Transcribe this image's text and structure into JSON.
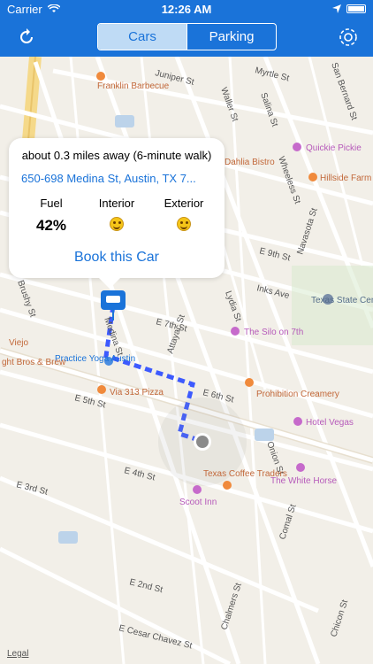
{
  "status": {
    "carrier": "Carrier",
    "time": "12:26 AM"
  },
  "nav": {
    "tabs": [
      {
        "label": "Cars",
        "active": true
      },
      {
        "label": "Parking",
        "active": false
      }
    ]
  },
  "popup": {
    "distance": "about 0.3 miles away (6-minute walk)",
    "address": "650-698 Medina St, Austin, TX 7...",
    "fuel_label": "Fuel",
    "fuel_value": "42%",
    "interior_label": "Interior",
    "exterior_label": "Exterior",
    "book_label": "Book this Car"
  },
  "map": {
    "streets": [
      "Juniper St",
      "Myrtle St",
      "Waller St",
      "Salina St",
      "Wheeless St",
      "Navasota St",
      "E 9th St",
      "Inks Ave",
      "Lydia St",
      "E 7th St",
      "E 6th St",
      "E 5th St",
      "E 4th St",
      "E 3rd St",
      "E 2nd St",
      "E Cesar Chavez St",
      "Comal St",
      "Chalmers St",
      "Onion St",
      "Attayac St",
      "Medina St",
      "San Bernard St",
      "Brushy St",
      "Chicon St"
    ],
    "pois": [
      "Franklin Barbecue",
      "Quickie Pickie",
      "Hillside Farm",
      "Texas State Cemetery",
      "The Silo on 7th",
      "Practice Yoga Austin",
      "Via 313 Pizza",
      "Prohibition Creamery",
      "Hotel Vegas",
      "Texas Coffee Traders",
      "The White Horse",
      "Scoot Inn",
      "Dahlia Bistro",
      "Viejo",
      "ght Bros & Brew"
    ],
    "legal": "Legal"
  },
  "colors": {
    "accent": "#1a73d9",
    "route": "#3d5afe"
  }
}
